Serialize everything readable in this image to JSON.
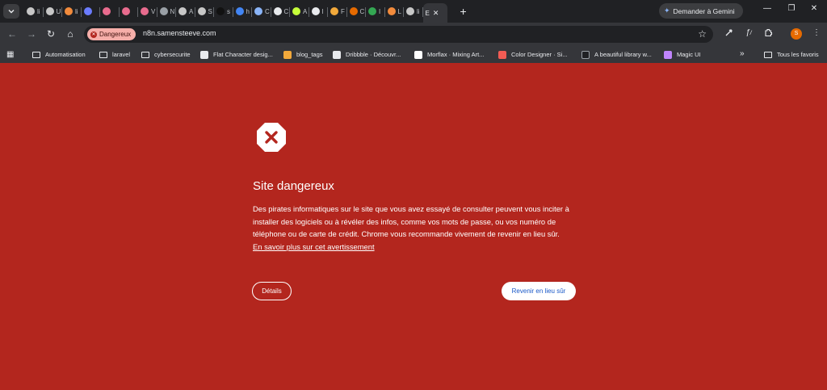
{
  "tabstrip": {
    "tabs": [
      {
        "text": "li",
        "color": "#c7c7c7"
      },
      {
        "text": "U",
        "color": "#c7c7c7"
      },
      {
        "text": "li",
        "color": "#f28b3c"
      },
      {
        "text": "",
        "color": "#6b7cff"
      },
      {
        "text": "",
        "color": "#e86b8e"
      },
      {
        "text": "",
        "color": "#e86b8e"
      },
      {
        "text": "V",
        "color": "#e86b8e"
      },
      {
        "text": "N",
        "color": "#9aa0a6"
      },
      {
        "text": "A",
        "color": "#c7c7c7"
      },
      {
        "text": "S",
        "color": "#c7c7c7"
      },
      {
        "text": "s",
        "color": "#111111"
      },
      {
        "text": "h",
        "color": "#4285f4"
      },
      {
        "text": "C",
        "color": "#8ab4f8"
      },
      {
        "text": "C",
        "color": "#e8eaed"
      },
      {
        "text": "A",
        "color": "#c6ff3a"
      },
      {
        "text": "I",
        "color": "#e8eaed"
      },
      {
        "text": "F",
        "color": "#f2a93b"
      },
      {
        "text": "C",
        "color": "#e66a00"
      },
      {
        "text": "I",
        "color": "#34a853"
      },
      {
        "text": "L",
        "color": "#f28b3c"
      },
      {
        "text": "li",
        "color": "#c7c7c7"
      }
    ],
    "active_tab": {
      "text": "E",
      "color": "#b3261e"
    },
    "close_label": "✕",
    "new_tab_label": "+",
    "gemini_label": "Demander à Gemini",
    "minimize_label": "—",
    "restore_label": "❐",
    "close_window_label": "✕"
  },
  "toolbar": {
    "back_label": "←",
    "forward_label": "→",
    "reload_label": "↻",
    "home_label": "⌂",
    "security_chip": "Dangereux",
    "security_chip_icon": "✕",
    "url": "n8n.samensteeve.com",
    "star_label": "☆",
    "profile_initial": "S"
  },
  "bookmarks": {
    "apps_label": "▦",
    "items": [
      {
        "label": "Automatisation",
        "icon": "folder-icon"
      },
      {
        "label": "laravel",
        "icon": "folder-icon"
      },
      {
        "label": "cybersecurite",
        "icon": "folder-icon"
      },
      {
        "label": "Flat Character desig...",
        "icon": "site-icon",
        "color": "#e8eaed"
      },
      {
        "label": "blog_tags",
        "icon": "site-icon",
        "color": "#f2a93b"
      },
      {
        "label": "Dribbble · Découvr...",
        "icon": "site-icon",
        "color": "#e8eaed"
      },
      {
        "label": "Morflax · Mixing Art...",
        "icon": "site-icon",
        "color": "#ffffff"
      },
      {
        "label": "Color Designer · Si...",
        "icon": "site-icon",
        "color": "#f25c54"
      },
      {
        "label": "A beautiful library w...",
        "icon": "site-icon",
        "color": "#202124"
      },
      {
        "label": "Magic UI",
        "icon": "site-icon",
        "color": "#c084fc"
      }
    ],
    "overflow_label": "»",
    "all_bookmarks_label": "Tous les favoris"
  },
  "page": {
    "title": "Site dangereux",
    "body": "Des pirates informatiques sur le site que vous avez essayé de consulter peuvent vous inciter à installer des logiciels ou à révéler des infos, comme vos mots de passe, ou vos numéro de téléphone ou de carte de crédit. Chrome vous recommande vivement de revenir en lieu sûr.",
    "learn_more_link": "En savoir plus sur cet avertissement",
    "details_button": "Détails",
    "back_button": "Revenir en lieu sûr"
  },
  "colors": {
    "danger_background": "#b3261e",
    "chrome_dark": "#202124",
    "chrome_toolbar": "#35363a",
    "chip_background": "#f6aea9",
    "back_button_text": "#1a59c8"
  }
}
